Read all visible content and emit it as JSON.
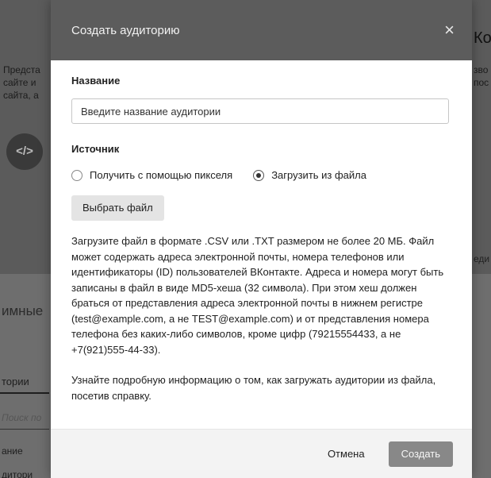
{
  "background": {
    "left_description": "Предста\nсайте и\nсайта, а",
    "right_title": "Ко",
    "right_description": "зво\nпос",
    "code_icon_glyph": "</>",
    "right_short": "еди",
    "section_title": "имные",
    "tab_label": "тории",
    "search_placeholder": "Поиск по",
    "column_name": "ание",
    "column_second": "дитори"
  },
  "modal": {
    "title": "Создать аудиторию",
    "close_glyph": "×",
    "name_label": "Название",
    "name_placeholder": "Введите название аудитории",
    "source_label": "Источник",
    "source_options": [
      {
        "label": "Получить с помощью пикселя",
        "checked": false
      },
      {
        "label": "Загрузить из файла",
        "checked": true
      }
    ],
    "choose_file_label": "Выбрать файл",
    "help_text": "Загрузите файл в формате .CSV или .TXT размером не более 20 МБ. Файл может содержать адреса электронной почты, номера телефонов или идентификаторы (ID) пользователей ВКонтакте. Адреса и номера могут быть записаны в файл в виде MD5-хеша (32 символа). При этом хеш должен браться от представления адреса электронной почты в нижнем регистре (test@example.com, а не TEST@example.com) и от представления номера телефона без каких-либо символов, кроме цифр (79215554433, а не +7(921)555-44-33).",
    "help_link_text": "Узнайте подробную информацию о том, как загружать аудитории из файла, посетив справку.",
    "cancel_label": "Отмена",
    "create_label": "Создать"
  },
  "colors": {
    "header_bg": "#5c5c5c",
    "create_button_bg": "#888888",
    "footer_bg": "#f3f3f3"
  }
}
